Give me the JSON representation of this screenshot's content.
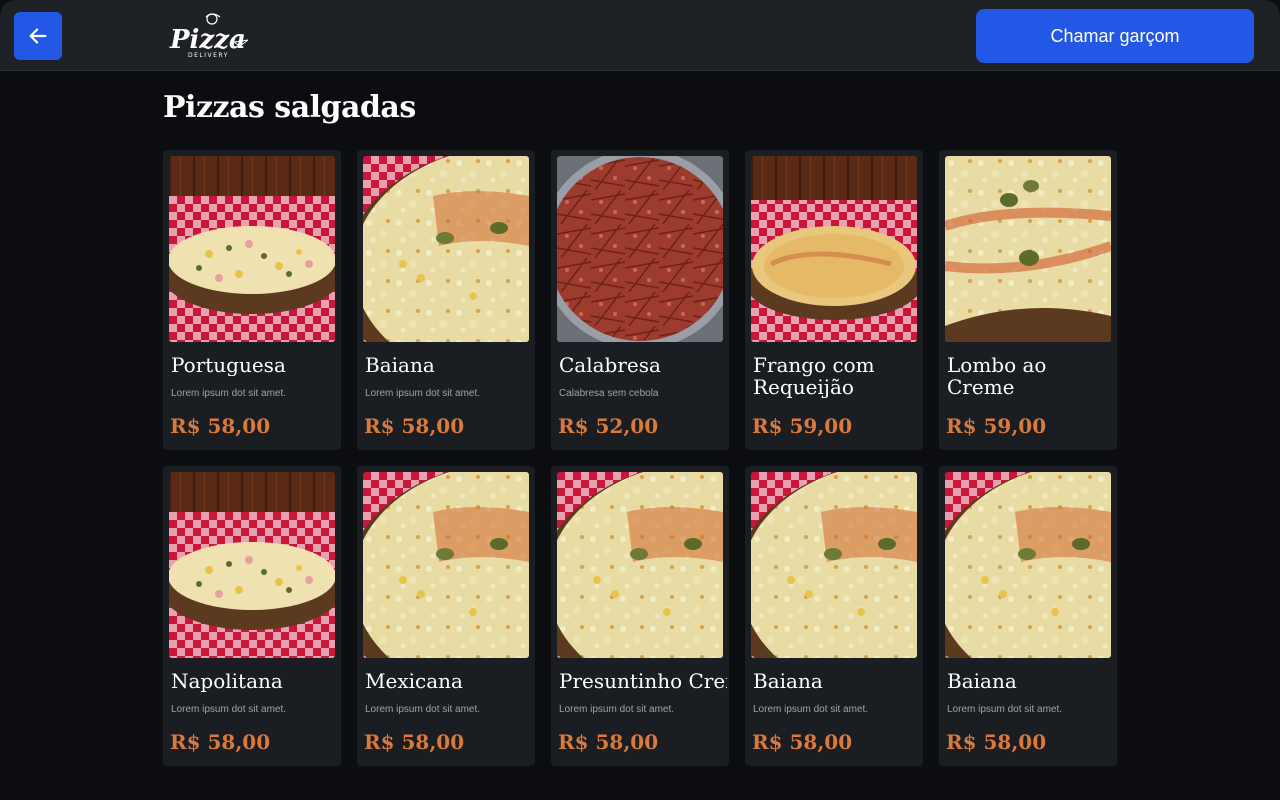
{
  "header": {
    "back_icon": "arrow-left-icon",
    "logo_text": "Pizza",
    "logo_sub": "DELIVERY",
    "call_waiter_label": "Chamar garçom"
  },
  "section": {
    "title": "Pizzas salgadas"
  },
  "colors": {
    "accent": "#2358e6",
    "price": "#d9793b",
    "card_bg": "#1a1d22",
    "page_bg": "#0b0d11"
  },
  "products": [
    {
      "name": "Portuguesa",
      "description": "Lorem ipsum dot sit amet.",
      "price": "R$ 58,00",
      "image": "pizza-portuguesa-photo"
    },
    {
      "name": "Baiana",
      "description": "Lorem ipsum dot sit amet.",
      "price": "R$ 58,00",
      "image": "pizza-closeup-photo"
    },
    {
      "name": "Calabresa",
      "description": "Calabresa sem cebola",
      "price": "R$ 52,00",
      "image": "pizza-calabresa-photo"
    },
    {
      "name": "Frango com Requeijão",
      "description": "",
      "price": "R$ 59,00",
      "image": "pizza-frango-photo"
    },
    {
      "name": "Lombo ao Creme",
      "description": "",
      "price": "R$ 59,00",
      "image": "pizza-lombo-photo"
    },
    {
      "name": "Napolitana",
      "description": "Lorem ipsum dot sit amet.",
      "price": "R$ 58,00",
      "image": "pizza-portuguesa-photo"
    },
    {
      "name": "Mexicana",
      "description": "Lorem ipsum dot sit amet.",
      "price": "R$ 58,00",
      "image": "pizza-closeup-photo"
    },
    {
      "name": "Presuntinho Cremoso",
      "description": "Lorem ipsum dot sit amet.",
      "price": "R$ 58,00",
      "image": "pizza-closeup-photo"
    },
    {
      "name": "Baiana",
      "description": "Lorem ipsum dot sit amet.",
      "price": "R$ 58,00",
      "image": "pizza-closeup-photo"
    },
    {
      "name": "Baiana",
      "description": "Lorem ipsum dot sit amet.",
      "price": "R$ 58,00",
      "image": "pizza-closeup-photo"
    }
  ]
}
